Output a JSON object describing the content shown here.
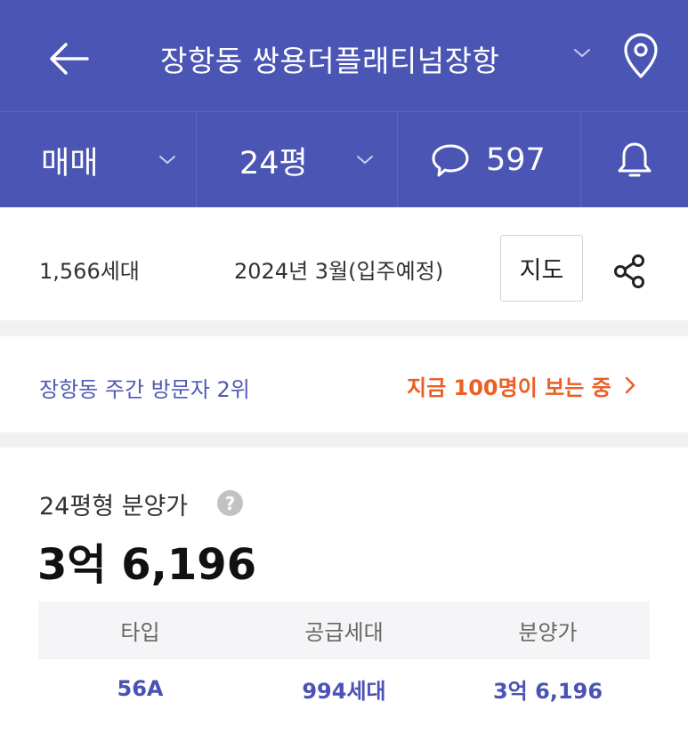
{
  "header": {
    "title": "장항동 쌍용더플래티넘장항",
    "back_icon": "arrow-left-icon",
    "location_icon": "map-pin-icon",
    "colors": {
      "background": "#4b55b3",
      "text": "#ffffff"
    }
  },
  "filters": {
    "trade_type": "매매",
    "area": "24평",
    "comment_count": "597",
    "comment_icon": "speech-bubble-icon",
    "alert_icon": "bell-icon"
  },
  "info": {
    "households": "1,566세대",
    "move_in": "2024년 3월(입주예정)",
    "map_button": "지도",
    "share_icon": "share-icon"
  },
  "ranking": {
    "text": "장항동 주간 방문자 2위",
    "viewers": "지금 100명이 보는 중",
    "colors": {
      "rank": "#5059b4",
      "viewers": "#ec5e23"
    }
  },
  "price": {
    "label": "24평형 분양가",
    "help": "?",
    "value": "3억 6,196",
    "table": {
      "headers": [
        "타입",
        "공급세대",
        "분양가"
      ],
      "rows": [
        [
          "56A",
          "994세대",
          "3억 6,196"
        ]
      ]
    }
  }
}
